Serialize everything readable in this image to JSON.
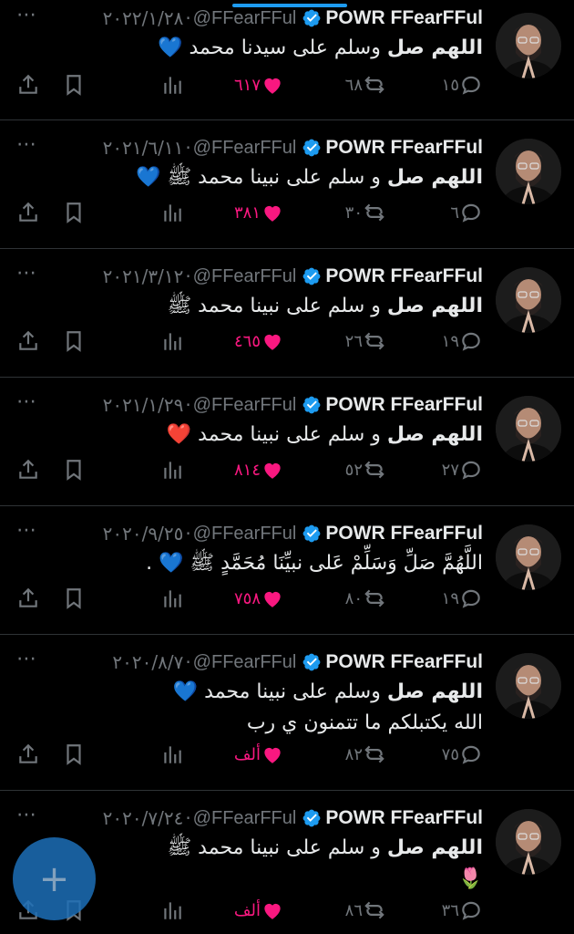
{
  "author": {
    "name": "POWR FFearFFul",
    "handle": "@FFearFFul"
  },
  "more_icon": "⋯",
  "colors": {
    "accent": "#1d9bf0",
    "like": "#f91880",
    "muted": "#71767b"
  },
  "tweets": [
    {
      "date": "٢٠٢٢/١/٢٨",
      "line1_bold": "اللهم صل",
      "line1_rest": " وسلم على سيدنا محمد ",
      "emoji": "💙",
      "line2": "",
      "line3": "",
      "replies": "١٥",
      "retweets": "٦٨",
      "likes": "٦١٧"
    },
    {
      "date": "٢٠٢١/٦/١١",
      "line1_bold": "اللهم صل",
      "line1_rest": " و سلم على نبينا محمد ﷺ ",
      "emoji": "💙",
      "line2": "",
      "line3": "",
      "replies": "٦",
      "retweets": "٣٠",
      "likes": "٣٨١"
    },
    {
      "date": "٢٠٢١/٣/١٢",
      "line1_bold": "اللهم صل",
      "line1_rest": " و سلم على نبينا محمد ﷺ",
      "emoji": "",
      "line2": "",
      "line3": "",
      "replies": "١٩",
      "retweets": "٢٦",
      "likes": "٤٦٥"
    },
    {
      "date": "٢٠٢١/١/٢٩",
      "line1_bold": "اللهم صل",
      "line1_rest": "ِ و سلم على نبينا محمد ",
      "emoji": "❤️",
      "line2": "",
      "line3": "",
      "replies": "٢٧",
      "retweets": "٥٢",
      "likes": "٨١٤"
    },
    {
      "date": "٢٠٢٠/٩/٢٥",
      "line1_bold": "",
      "line1_rest": "اللَّهُمَّ صَلِّ وَسَلِّمْ عَلى نبيِّنَا مُحَمَّدٍ ﷺ ",
      "emoji": "💙",
      "line2": " .",
      "line3": "",
      "replies": "١٩",
      "retweets": "٨٠",
      "likes": "٧٥٨"
    },
    {
      "date": "٢٠٢٠/٨/٧",
      "line1_bold": "اللهم صل",
      "line1_rest": " وسلم على نبينا محمد ",
      "emoji": "💙",
      "line2": "",
      "line3": "الله يكتبلكم ما تتمنون ي رب",
      "replies": "٧٥",
      "retweets": "٨٢",
      "likes": "ألف"
    },
    {
      "date": "٢٠٢٠/٧/٢٤",
      "line1_bold": "اللهم صل",
      "line1_rest": " و سلم على نبينا محمد ﷺ",
      "emoji": "",
      "line2": "",
      "line3": "🌷",
      "replies": "٣٦",
      "retweets": "٨٦",
      "likes": "ألف"
    }
  ],
  "compose_button": "+"
}
